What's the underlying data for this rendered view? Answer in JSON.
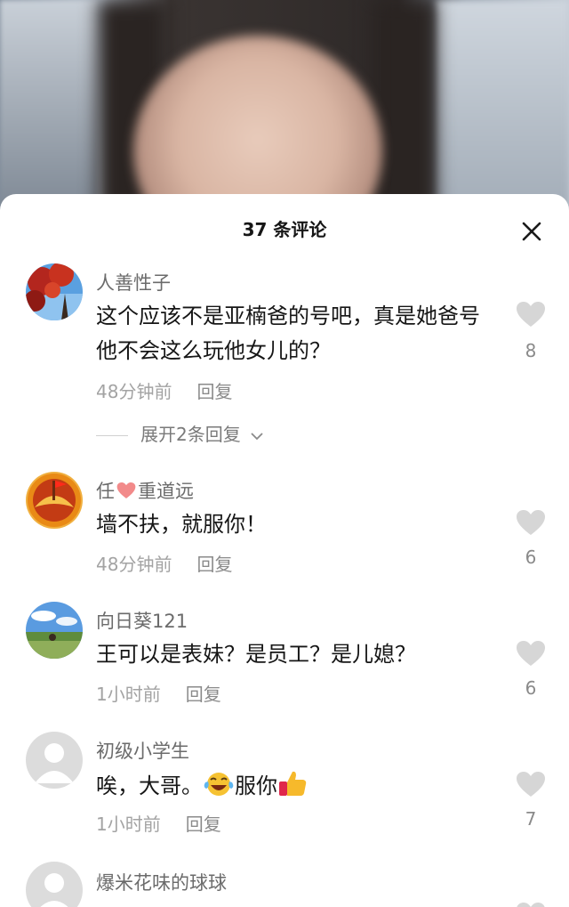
{
  "header": {
    "title": "37 条评论"
  },
  "comments": [
    {
      "name": "人善性子",
      "text": "这个应该不是亚楠爸的号吧，真是她爸号他不会这么玩他女儿的？",
      "time": "48分钟前",
      "reply_label": "回复",
      "likes": "8",
      "avatar_icon": "red-leaves-avatar"
    },
    {
      "name_prefix": "任",
      "name_heart_icon": "heart-icon",
      "name_suffix": "重道远",
      "text": "墙不扶，就服你！",
      "time": "48分钟前",
      "reply_label": "回复",
      "likes": "6",
      "avatar_icon": "flag-emblem-avatar"
    },
    {
      "name": "向日葵121",
      "text": "王可以是表妹？是员工？是儿媳？",
      "time": "1小时前",
      "reply_label": "回复",
      "likes": "6",
      "avatar_icon": "landscape-avatar"
    },
    {
      "name": "初级小学生",
      "text_prefix": "唉，大哥。",
      "emoji_1": "tears-of-joy-emoji",
      "text_middle": "服你",
      "emoji_2": "thumbs-up-emoji",
      "time": "1小时前",
      "reply_label": "回复",
      "likes": "7",
      "avatar_icon": "default-user-avatar"
    },
    {
      "name": "爆米花味的球球",
      "avatar_icon": "default-user-avatar"
    }
  ],
  "expand_replies": "展开2条回复",
  "colors": {
    "like_icon": "#d6d6d6",
    "sheet_bg": "#ffffff",
    "name": "#6b6b6b"
  }
}
